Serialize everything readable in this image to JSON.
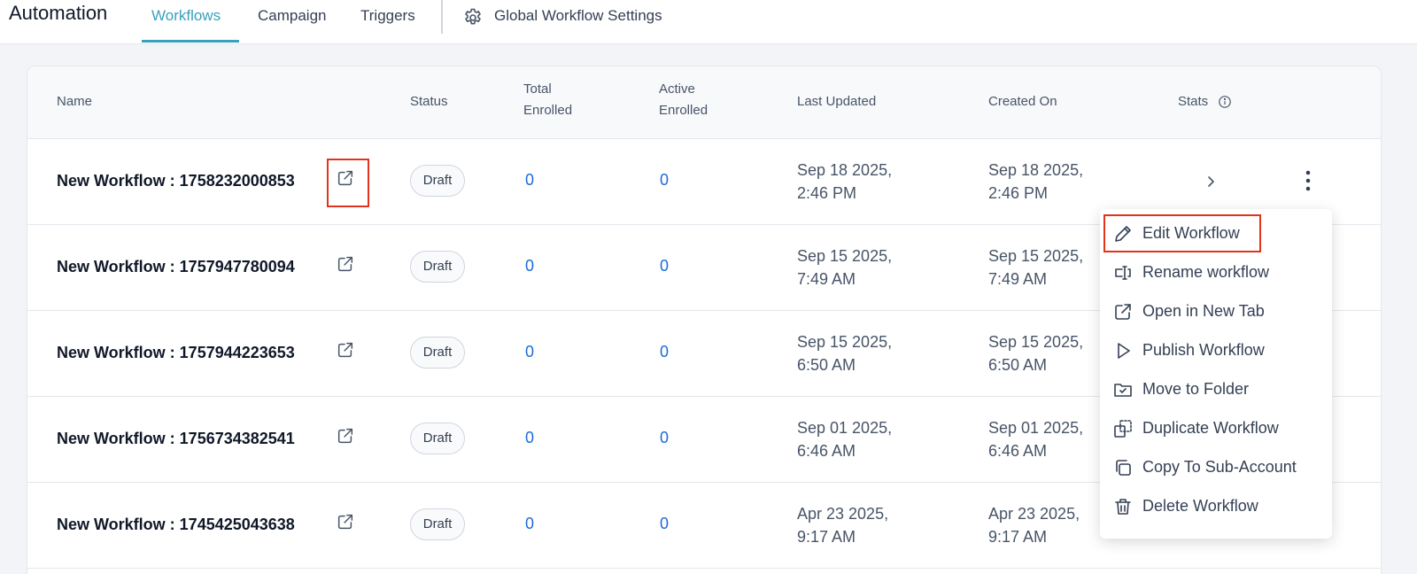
{
  "header": {
    "title": "Automation",
    "tabs": [
      {
        "label": "Workflows",
        "active": true
      },
      {
        "label": "Campaign",
        "active": false
      },
      {
        "label": "Triggers",
        "active": false
      }
    ],
    "settings_label": "Global Workflow Settings",
    "settings_icon": "gear-icon",
    "accent_color": "#3aa0bc"
  },
  "table": {
    "columns": {
      "name": "Name",
      "status": "Status",
      "total_enrolled": "Total Enrolled",
      "active_enrolled": "Active Enrolled",
      "last_updated": "Last Updated",
      "created_on": "Created On",
      "stats": "Stats"
    },
    "rows": [
      {
        "name": "New Workflow : 1758232000853",
        "status": "Draft",
        "total": "0",
        "active": "0",
        "updated_date": "Sep 18 2025,",
        "updated_time": "2:46 PM",
        "created_date": "Sep 18 2025,",
        "created_time": "2:46 PM"
      },
      {
        "name": "New Workflow : 1757947780094",
        "status": "Draft",
        "total": "0",
        "active": "0",
        "updated_date": "Sep 15 2025,",
        "updated_time": "7:49 AM",
        "created_date": "Sep 15 2025,",
        "created_time": "7:49 AM"
      },
      {
        "name": "New Workflow : 1757944223653",
        "status": "Draft",
        "total": "0",
        "active": "0",
        "updated_date": "Sep 15 2025,",
        "updated_time": "6:50 AM",
        "created_date": "Sep 15 2025,",
        "created_time": "6:50 AM"
      },
      {
        "name": "New Workflow : 1756734382541",
        "status": "Draft",
        "total": "0",
        "active": "0",
        "updated_date": "Sep 01 2025,",
        "updated_time": "6:46 AM",
        "created_date": "Sep 01 2025,",
        "created_time": "6:46 AM"
      },
      {
        "name": "New Workflow : 1745425043638",
        "status": "Draft",
        "total": "0",
        "active": "0",
        "updated_date": "Apr 23 2025,",
        "updated_time": "9:17 AM",
        "created_date": "Apr 23 2025,",
        "created_time": "9:17 AM"
      }
    ]
  },
  "context_menu": {
    "items": [
      {
        "label": "Edit Workflow",
        "icon": "pencil-icon"
      },
      {
        "label": "Rename workflow",
        "icon": "rename-icon"
      },
      {
        "label": "Open in New Tab",
        "icon": "external-link-icon"
      },
      {
        "label": "Publish Workflow",
        "icon": "play-icon"
      },
      {
        "label": "Move to Folder",
        "icon": "folder-check-icon"
      },
      {
        "label": "Duplicate Workflow",
        "icon": "duplicate-icon"
      },
      {
        "label": "Copy To Sub-Account",
        "icon": "copy-icon"
      },
      {
        "label": "Delete Workflow",
        "icon": "trash-icon"
      }
    ]
  },
  "colors": {
    "link_number": "#1d6ad6",
    "highlight_box": "#e0351b"
  }
}
